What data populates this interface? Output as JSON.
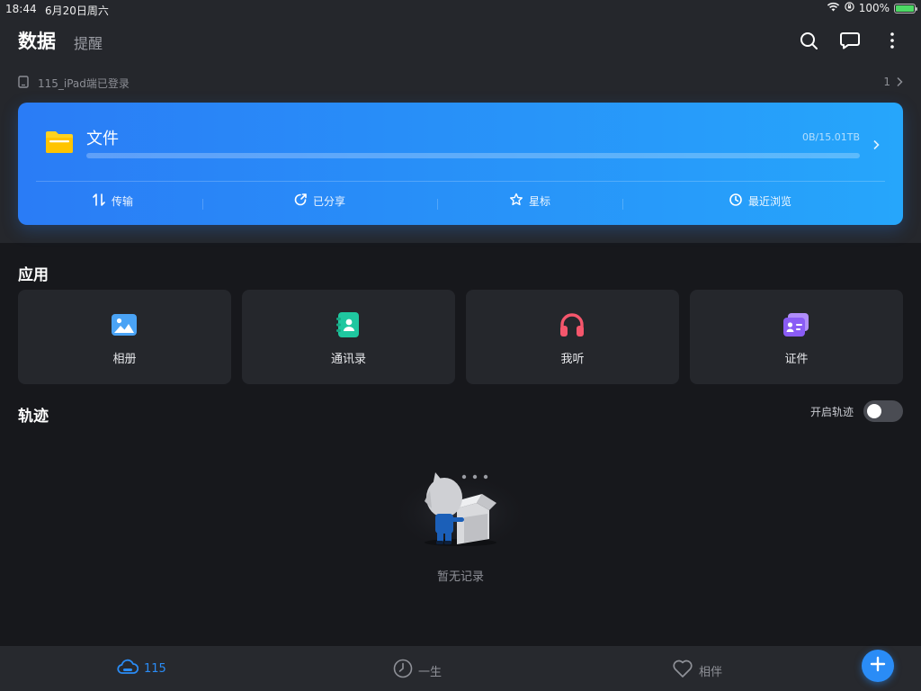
{
  "status_bar": {
    "time": "18:44",
    "date": "6月20日周六",
    "battery": "100%",
    "icons": [
      "wifi-icon",
      "orientation-lock-icon",
      "battery-icon"
    ]
  },
  "header": {
    "tabs": [
      {
        "label": "数据",
        "active": true
      },
      {
        "label": "提醒",
        "active": false
      }
    ],
    "icons": [
      "search-icon",
      "message-icon",
      "more-icon"
    ]
  },
  "login": {
    "text": "115_iPad端已登录",
    "count": "1",
    "icon": "tablet-icon"
  },
  "file_card": {
    "title": "文件",
    "size": "0B/15.01TB",
    "usage_fraction": 0,
    "icon": "folder-icon",
    "actions": [
      {
        "label": "传输",
        "icon": "transfer-icon"
      },
      {
        "label": "已分享",
        "icon": "share-icon"
      },
      {
        "label": "星标",
        "icon": "star-icon"
      },
      {
        "label": "最近浏览",
        "icon": "history-icon"
      }
    ],
    "colors": {
      "gradient_start": "#2a7cf6",
      "gradient_end": "#26a6fb"
    }
  },
  "apps": {
    "title": "应用",
    "items": [
      {
        "label": "相册",
        "icon": "photo-icon",
        "color": "#4aa3f5"
      },
      {
        "label": "通讯录",
        "icon": "contacts-icon",
        "color": "#1fc7a0"
      },
      {
        "label": "我听",
        "icon": "headphones-icon",
        "color": "#f5566c"
      },
      {
        "label": "证件",
        "icon": "id-card-icon",
        "color": "#8a5cf5"
      }
    ]
  },
  "track": {
    "title": "轨迹",
    "toggle_label": "开启轨迹",
    "toggle_on": false,
    "empty_text": "暂无记录"
  },
  "bottom_nav": {
    "items": [
      {
        "label": "115",
        "icon": "cloud-icon",
        "active": true
      },
      {
        "label": "一生",
        "icon": "clock-icon",
        "active": false
      },
      {
        "label": "相伴",
        "icon": "heart-icon",
        "active": false
      }
    ],
    "fab_icon": "plus-icon",
    "accent": "#2a8cf6"
  }
}
